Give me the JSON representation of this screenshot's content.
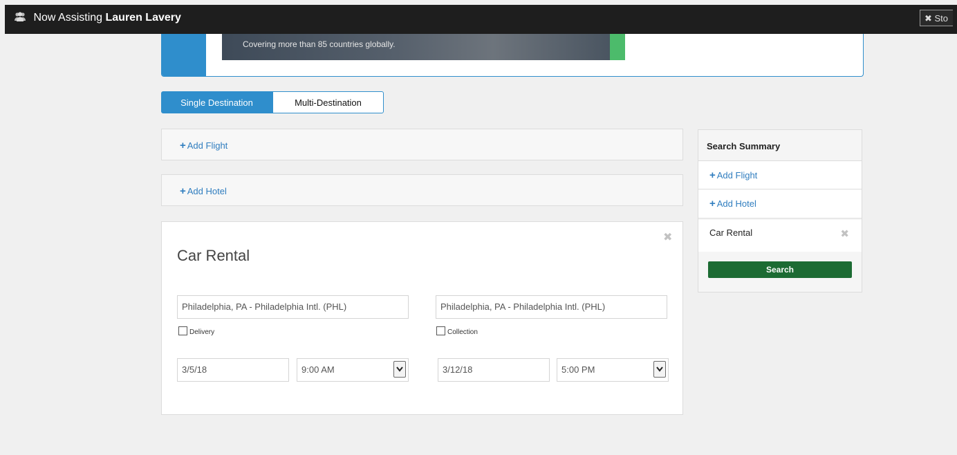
{
  "topbar": {
    "assisting_prefix": "Now Assisting",
    "user_name": "Lauren Lavery",
    "stop_label": "✖ Sto"
  },
  "banner": {
    "tagline": "Covering more than 85 countries globally."
  },
  "tabs": [
    {
      "label": "Single Destination",
      "active": true
    },
    {
      "label": "Multi-Destination",
      "active": false
    }
  ],
  "sections": {
    "add_flight": "Add Flight",
    "add_hotel": "Add Hotel"
  },
  "car_rental": {
    "title": "Car Rental",
    "pickup_location": "Philadelphia, PA - Philadelphia Intl. (PHL)",
    "dropoff_location": "Philadelphia, PA - Philadelphia Intl. (PHL)",
    "delivery_label": "Delivery",
    "collection_label": "Collection",
    "pickup_date": "3/5/18",
    "pickup_time": "9:00 AM",
    "dropoff_date": "3/12/18",
    "dropoff_time": "5:00 PM"
  },
  "summary": {
    "title": "Search Summary",
    "add_flight": "Add Flight",
    "add_hotel": "Add Hotel",
    "car_rental": "Car Rental",
    "search_label": "Search"
  },
  "colors": {
    "accent_blue": "#2f8ecc",
    "search_green": "#1c6b33",
    "topbar": "#1e1e1e"
  },
  "icons": [
    "people-icon",
    "plus-icon",
    "close-icon",
    "chevron-down-icon"
  ]
}
